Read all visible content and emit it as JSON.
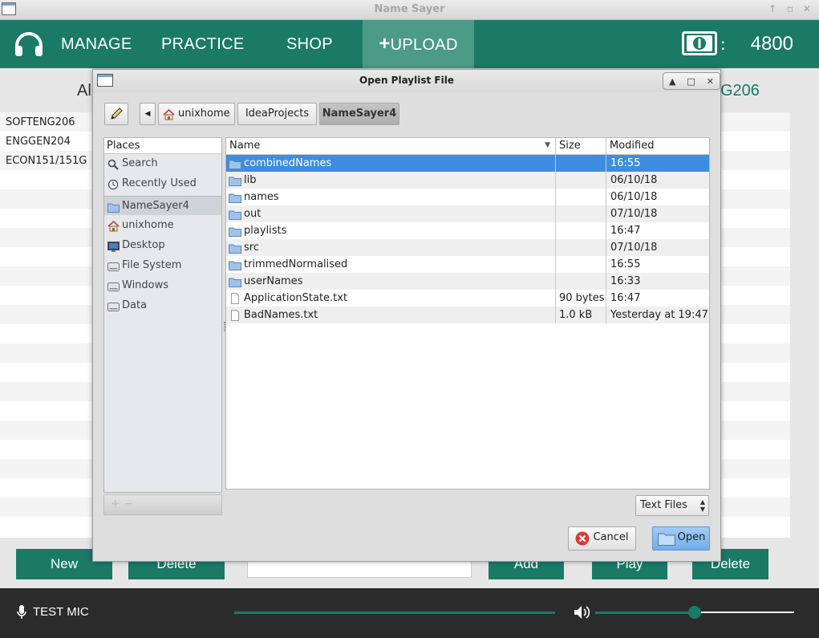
{
  "window": {
    "title": "Name Sayer"
  },
  "nav": {
    "manage": "MANAGE",
    "practice": "PRACTICE",
    "shop": "SHOP",
    "upload": "UPLOAD",
    "coin_sep": ":",
    "coins": "4800"
  },
  "main": {
    "heading_left": "Al",
    "heading_right": "G206",
    "courses": [
      "SOFTENG206",
      "ENGGEN204",
      "ECON151/151G"
    ],
    "buttons": {
      "new": "New",
      "delete_left": "Delete",
      "add": "Add",
      "play": "Play",
      "delete_right": "Delete"
    }
  },
  "bottom": {
    "test_mic": "TEST MIC",
    "volume_level": 0.5
  },
  "dialog": {
    "title": "Open Playlist File",
    "breadcrumbs": [
      "unixhome",
      "IdeaProjects",
      "NameSayer4"
    ],
    "places_header": "Places",
    "places": [
      {
        "label": "Search",
        "icon": "search-icon"
      },
      {
        "label": "Recently Used",
        "icon": "clock-icon"
      },
      {
        "label": "NameSayer4",
        "icon": "folder-icon"
      },
      {
        "label": "unixhome",
        "icon": "home-icon"
      },
      {
        "label": "Desktop",
        "icon": "desktop-icon"
      },
      {
        "label": "File System",
        "icon": "drive-icon"
      },
      {
        "label": "Windows",
        "icon": "drive-icon"
      },
      {
        "label": "Data",
        "icon": "drive-icon"
      }
    ],
    "places_footer": "+ −",
    "columns": {
      "name": "Name",
      "size": "Size",
      "modified": "Modified"
    },
    "files": [
      {
        "name": "combinedNames",
        "size": "",
        "modified": "16:55",
        "type": "folder"
      },
      {
        "name": "lib",
        "size": "",
        "modified": "06/10/18",
        "type": "folder"
      },
      {
        "name": "names",
        "size": "",
        "modified": "06/10/18",
        "type": "folder"
      },
      {
        "name": "out",
        "size": "",
        "modified": "07/10/18",
        "type": "folder"
      },
      {
        "name": "playlists",
        "size": "",
        "modified": "16:47",
        "type": "folder"
      },
      {
        "name": "src",
        "size": "",
        "modified": "07/10/18",
        "type": "folder"
      },
      {
        "name": "trimmedNormalised",
        "size": "",
        "modified": "16:55",
        "type": "folder"
      },
      {
        "name": "userNames",
        "size": "",
        "modified": "16:33",
        "type": "folder"
      },
      {
        "name": "ApplicationState.txt",
        "size": "90 bytes",
        "modified": "16:47",
        "type": "file"
      },
      {
        "name": "BadNames.txt",
        "size": "1.0 kB",
        "modified": "Yesterday at 19:47",
        "type": "file"
      }
    ],
    "filter": "Text Files",
    "cancel": "Cancel",
    "open": "Open"
  },
  "colors": {
    "accent": "#1a7a66",
    "accent_light": "#4c9a88",
    "selection": "#3d8ee0",
    "bottom_bar": "#2b2b2b"
  }
}
